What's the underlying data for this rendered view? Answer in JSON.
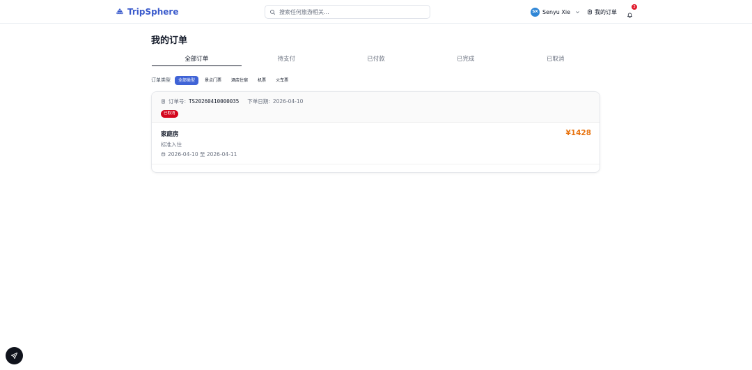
{
  "header": {
    "brand": "TripSphere",
    "search_placeholder": "搜索任何旅游相关...",
    "user": {
      "initials": "SX",
      "name": "Senyu Xie"
    },
    "orders_link": "我的订单",
    "notification_count": "3"
  },
  "page": {
    "title": "我的订单",
    "tabs": [
      {
        "label": "全部订单",
        "active": true
      },
      {
        "label": "待支付",
        "active": false
      },
      {
        "label": "已付款",
        "active": false
      },
      {
        "label": "已完成",
        "active": false
      },
      {
        "label": "已取消",
        "active": false
      }
    ],
    "filter": {
      "label": "订单类型",
      "chips": [
        {
          "label": "全部类型",
          "active": true
        },
        {
          "label": "景点门票",
          "active": false
        },
        {
          "label": "酒店住宿",
          "active": false
        },
        {
          "label": "机票",
          "active": false
        },
        {
          "label": "火车票",
          "active": false
        }
      ]
    }
  },
  "orders": [
    {
      "order_no_label": "订单号:",
      "order_no": "TS20260410000035",
      "order_date_label": "下单日期:",
      "order_date": "2026-04-10",
      "status": "已取消",
      "item_name": "家庭房",
      "item_desc": "标准入住",
      "stay_range": "2026-04-10 至 2026-04-11",
      "price": "¥1428"
    }
  ],
  "colors": {
    "brand": "#3b5bcc",
    "accent_chip": "#3f63d6",
    "status_cancelled": "#d4061d",
    "price": "#e8730e"
  },
  "icons": {
    "logo": "ship-icon",
    "search": "search-icon",
    "orders": "clipboard-icon",
    "bell": "bell-icon",
    "order": "receipt-icon",
    "date": "calendar-icon",
    "fab": "paper-plane-icon"
  }
}
